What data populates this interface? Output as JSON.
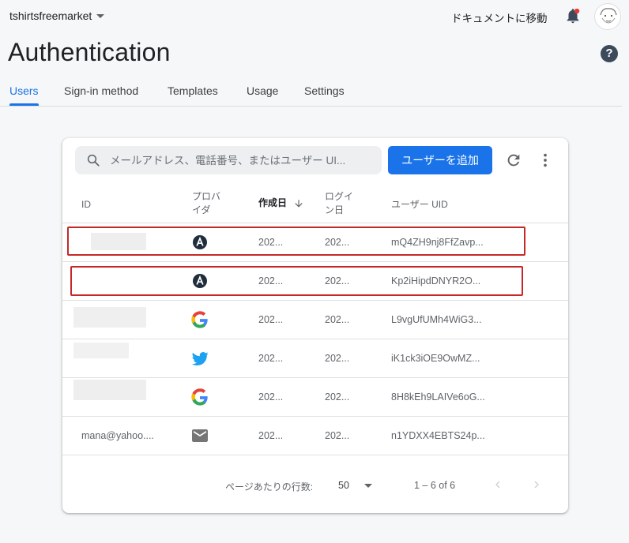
{
  "header": {
    "project_name": "tshirtsfreemarket",
    "doc_link": "ドキュメントに移動",
    "page_title": "Authentication",
    "help_glyph": "?"
  },
  "tabs": [
    {
      "label": "Users",
      "active": true
    },
    {
      "label": "Sign-in method",
      "active": false
    },
    {
      "label": "Templates",
      "active": false
    },
    {
      "label": "Usage",
      "active": false
    },
    {
      "label": "Settings",
      "active": false
    }
  ],
  "toolbar": {
    "search_placeholder": "メールアドレス、電話番号、またはユーザー UI...",
    "add_user_label": "ユーザーを追加"
  },
  "table": {
    "columns": {
      "id": "ID",
      "provider": "プロバイダ",
      "created": "作成日",
      "signed_in": "ログイン日",
      "uid": "ユーザー UID"
    },
    "sorted_column": "作成日",
    "rows": [
      {
        "id": "",
        "provider": "anonymous-icon",
        "created": "202...",
        "signed_in": "202...",
        "uid": "mQ4ZH9nj8FfZavp...",
        "highlighted": true
      },
      {
        "id": "",
        "provider": "anonymous-icon",
        "created": "202...",
        "signed_in": "202...",
        "uid": "Kp2iHipdDNYR2O...",
        "highlighted": true
      },
      {
        "id": "",
        "provider": "google-icon",
        "created": "202...",
        "signed_in": "202...",
        "uid": "L9vgUfUMh4WiG3...",
        "highlighted": false
      },
      {
        "id": "",
        "provider": "twitter-icon",
        "created": "202...",
        "signed_in": "202...",
        "uid": "iK1ck3iOE9OwMZ...",
        "highlighted": false
      },
      {
        "id": "",
        "provider": "google-icon",
        "created": "202...",
        "signed_in": "202...",
        "uid": "8H8kEh9LAIVe6oG...",
        "highlighted": false
      },
      {
        "id": "mana@yahoo....",
        "provider": "email-icon",
        "created": "202...",
        "signed_in": "202...",
        "uid": "n1YDXX4EBTS24p...",
        "highlighted": false
      }
    ]
  },
  "pagination": {
    "rows_per_page_label": "ページあたりの行数:",
    "rows_per_page": "50",
    "range": "1 – 6 of 6"
  },
  "colors": {
    "accent": "#1a73e8",
    "highlight_border": "#c62828"
  }
}
